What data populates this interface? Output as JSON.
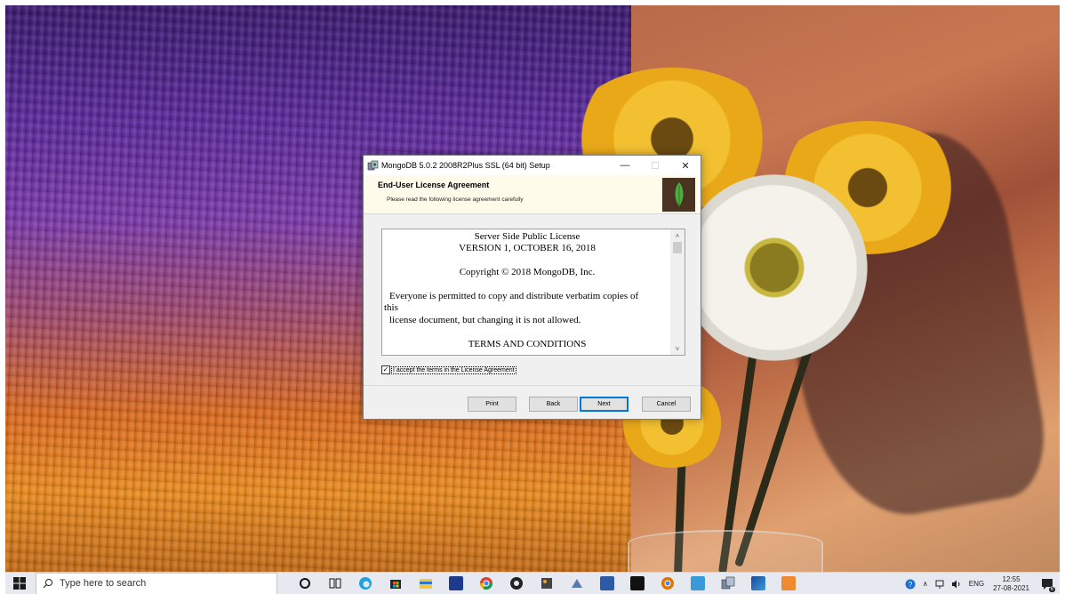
{
  "dialog": {
    "title": "MongoDB 5.0.2 2008R2Plus SSL (64 bit) Setup",
    "header_title": "End-User License Agreement",
    "header_subtitle": "Please read the following license agreement carefully",
    "license_lines": {
      "l1": "Server Side Public License",
      "l2": "VERSION 1, OCTOBER 16, 2018",
      "l3": "Copyright © 2018 MongoDB, Inc.",
      "l4": "Everyone is permitted to copy and distribute verbatim copies of",
      "l5": "this",
      "l6": "license document, but changing it is not allowed.",
      "l7": "TERMS AND CONDITIONS"
    },
    "accept_label": "I accept the terms in the License Agreement",
    "accept_checked": "✓",
    "buttons": {
      "print": "Print",
      "back": "Back",
      "next": "Next",
      "cancel": "Cancel"
    },
    "controls": {
      "minimize": "—",
      "maximize": "☐",
      "close": "✕"
    }
  },
  "taskbar": {
    "search_placeholder": "Type here to search",
    "tray": {
      "language": "ENG",
      "time": "12:55",
      "date": "27-08-2021",
      "notification_count": "6"
    },
    "pinned_icons": [
      "cortana-icon",
      "task-view-icon",
      "edge-icon",
      "store-icon",
      "file-explorer-icon",
      "powershell-icon",
      "chrome-icon",
      "obs-icon",
      "app-icon",
      "app-icon-2",
      "app-icon-3",
      "terminal-icon",
      "chrome-canary-icon",
      "photos-icon",
      "mongodb-setup-icon",
      "app-icon-4",
      "app-icon-5"
    ]
  },
  "colors": {
    "accent": "#0078d7",
    "mongo_leaf": "#4cae3f",
    "header_band": "#fffbea"
  }
}
